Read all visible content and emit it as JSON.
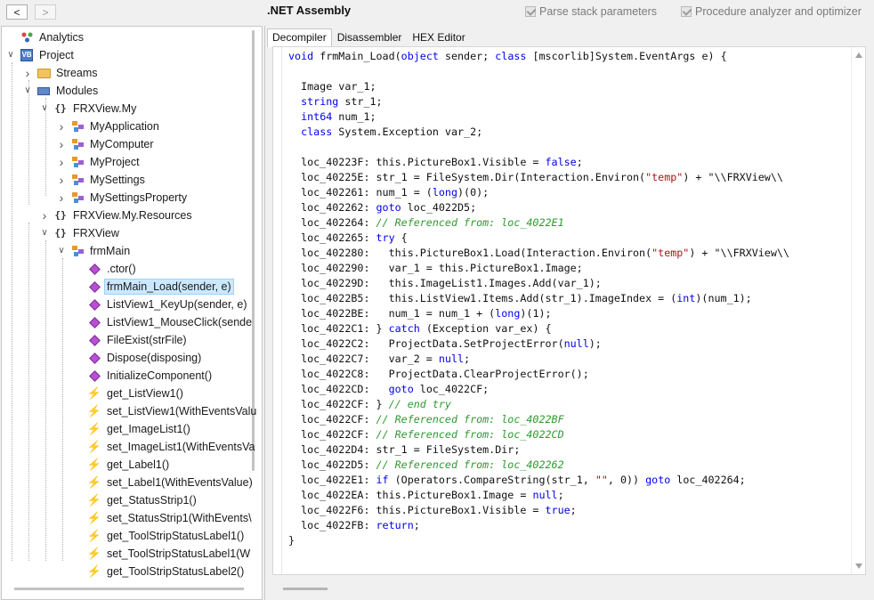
{
  "toolbar": {
    "back_label": "<",
    "forward_label": ">",
    "title": ".NET Assembly",
    "option1": "Parse stack parameters",
    "option2": "Procedure analyzer and optimizer"
  },
  "tree": {
    "items": [
      {
        "label": "Analytics",
        "icon": "analytics-icon"
      },
      {
        "label": "Project",
        "icon": "project-icon"
      },
      {
        "label": "Streams",
        "icon": "folder-icon"
      },
      {
        "label": "Modules",
        "icon": "modules-icon"
      },
      {
        "label": "FRXView.My",
        "icon": "namespace-icon"
      },
      {
        "label": "MyApplication",
        "icon": "class-icon"
      },
      {
        "label": "MyComputer",
        "icon": "class-icon"
      },
      {
        "label": "MyProject",
        "icon": "class-icon"
      },
      {
        "label": "MySettings",
        "icon": "class-icon"
      },
      {
        "label": "MySettingsProperty",
        "icon": "class-icon"
      },
      {
        "label": "FRXView.My.Resources",
        "icon": "namespace-icon"
      },
      {
        "label": "FRXView",
        "icon": "namespace-icon"
      },
      {
        "label": "frmMain",
        "icon": "class-icon"
      },
      {
        "label": ".ctor()",
        "icon": "method-icon"
      },
      {
        "label": "frmMain_Load(sender, e)",
        "icon": "method-icon"
      },
      {
        "label": "ListView1_KeyUp(sender, e)",
        "icon": "method-icon"
      },
      {
        "label": "ListView1_MouseClick(sende",
        "icon": "method-icon"
      },
      {
        "label": "FileExist(strFile)",
        "icon": "method-icon"
      },
      {
        "label": "Dispose(disposing)",
        "icon": "method-icon"
      },
      {
        "label": "InitializeComponent()",
        "icon": "method-icon"
      },
      {
        "label": "get_ListView1()",
        "icon": "property-icon"
      },
      {
        "label": "set_ListView1(WithEventsValu",
        "icon": "property-icon"
      },
      {
        "label": "get_ImageList1()",
        "icon": "property-icon"
      },
      {
        "label": "set_ImageList1(WithEventsVa",
        "icon": "property-icon"
      },
      {
        "label": "get_Label1()",
        "icon": "property-icon"
      },
      {
        "label": "set_Label1(WithEventsValue)",
        "icon": "property-icon"
      },
      {
        "label": "get_StatusStrip1()",
        "icon": "property-icon"
      },
      {
        "label": "set_StatusStrip1(WithEvents\\",
        "icon": "property-icon"
      },
      {
        "label": "get_ToolStripStatusLabel1()",
        "icon": "property-icon"
      },
      {
        "label": "set_ToolStripStatusLabel1(W",
        "icon": "property-icon"
      },
      {
        "label": "get_ToolStripStatusLabel2()",
        "icon": "property-icon"
      }
    ]
  },
  "tabs": [
    "Decompiler",
    "Disassembler",
    "HEX Editor"
  ],
  "code": {
    "lines": [
      "void frmMain_Load(object sender; class [mscorlib]System.EventArgs e) {",
      "",
      "  Image var_1;",
      "  string str_1;",
      "  int64 num_1;",
      "  class System.Exception var_2;",
      "",
      "  loc_40223F: this.PictureBox1.Visible = false;",
      "  loc_40225E: str_1 = FileSystem.Dir(Interaction.Environ(\"temp\") + \"\\\\FRXView\\\\",
      "  loc_402261: num_1 = (long)(0);",
      "  loc_402262: goto loc_4022D5;",
      "  loc_402264: // Referenced from: loc_4022E1",
      "  loc_402265: try {",
      "  loc_402280:   this.PictureBox1.Load(Interaction.Environ(\"temp\") + \"\\\\FRXView\\\\",
      "  loc_402290:   var_1 = this.PictureBox1.Image;",
      "  loc_40229D:   this.ImageList1.Images.Add(var_1);",
      "  loc_4022B5:   this.ListView1.Items.Add(str_1).ImageIndex = (int)(num_1);",
      "  loc_4022BE:   num_1 = num_1 + (long)(1);",
      "  loc_4022C1: } catch (Exception var_ex) {",
      "  loc_4022C2:   ProjectData.SetProjectError(null);",
      "  loc_4022C7:   var_2 = null;",
      "  loc_4022C8:   ProjectData.ClearProjectError();",
      "  loc_4022CD:   goto loc_4022CF;",
      "  loc_4022CF: } // end try",
      "  loc_4022CF: // Referenced from: loc_4022BF",
      "  loc_4022CF: // Referenced from: loc_4022CD",
      "  loc_4022D4: str_1 = FileSystem.Dir;",
      "  loc_4022D5: // Referenced from: loc_402262",
      "  loc_4022E1: if (Operators.CompareString(str_1, \"\", 0)) goto loc_402264;",
      "  loc_4022EA: this.PictureBox1.Image = null;",
      "  loc_4022F6: this.PictureBox1.Visible = true;",
      "  loc_4022FB: return;",
      "}"
    ]
  },
  "colors": {
    "keyword": "#0000ee",
    "comment": "#2e9a2e",
    "selection": "#cce8ff"
  }
}
